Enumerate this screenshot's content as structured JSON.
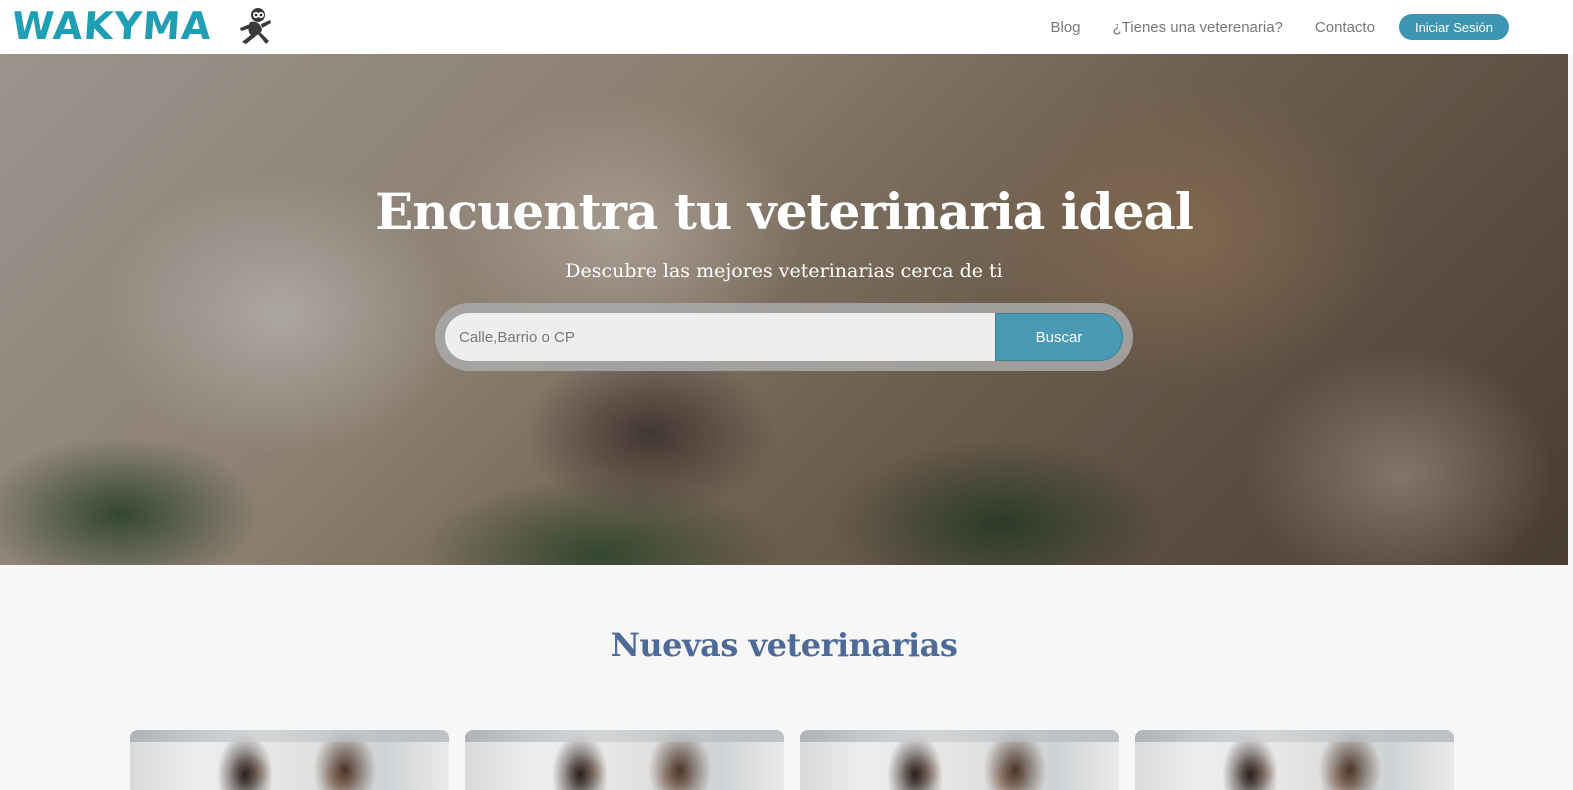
{
  "header": {
    "logo_text": "WAKYMA",
    "mascot_icon": "running-sloth-icon",
    "nav": {
      "blog": "Blog",
      "vet_question": "¿Tienes una veterenaria?",
      "contact": "Contacto",
      "login": "Iniciar Sesión"
    }
  },
  "hero": {
    "title": "Encuentra tu veterinaria ideal",
    "subtitle": "Descubre las mejores veterinarias cerca de ti",
    "search": {
      "placeholder": "Calle,Barrio o CP",
      "value": "",
      "button_label": "Buscar"
    }
  },
  "section": {
    "title": "Nuevas veterinarias",
    "cards": [
      {
        "image": "clinic-photo"
      },
      {
        "image": "clinic-photo"
      },
      {
        "image": "clinic-photo"
      },
      {
        "image": "clinic-photo"
      }
    ]
  },
  "colors": {
    "brand": "#1f9fb4",
    "accent": "#3e95b2",
    "section_title": "#4e6a96"
  }
}
